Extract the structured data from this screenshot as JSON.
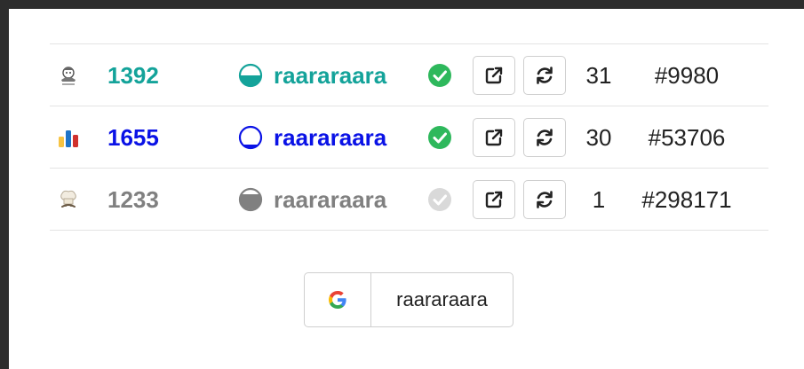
{
  "rows": [
    {
      "site_icon": "chef-logo-icon",
      "rating": "1392",
      "rating_color": "#14a39a",
      "rank_icon": "half-filled-circle-icon",
      "handle": "raararaara",
      "handle_color": "#14a39a",
      "verified": true,
      "check_color": "#2eb85c",
      "count": "31",
      "rank_position": "#9980"
    },
    {
      "site_icon": "bar-chart-icon",
      "rating": "1655",
      "rating_color": "#0a12e6",
      "rank_icon": "nearly-empty-circle-icon",
      "handle": "raararaara",
      "handle_color": "#0a12e6",
      "verified": true,
      "check_color": "#2eb85c",
      "count": "30",
      "rank_position": "#53706"
    },
    {
      "site_icon": "chef-hat-icon",
      "rating": "1233",
      "rating_color": "#808080",
      "rank_icon": "nearly-full-circle-icon",
      "handle": "raararaara",
      "handle_color": "#808080",
      "verified": false,
      "check_color": "#d9d9d9",
      "count": "1",
      "rank_position": "#298171"
    }
  ],
  "buttons": {
    "external_icon": "external-link-icon",
    "refresh_icon": "refresh-icon"
  },
  "google_account": {
    "icon": "google-icon",
    "label": "raararaara"
  }
}
